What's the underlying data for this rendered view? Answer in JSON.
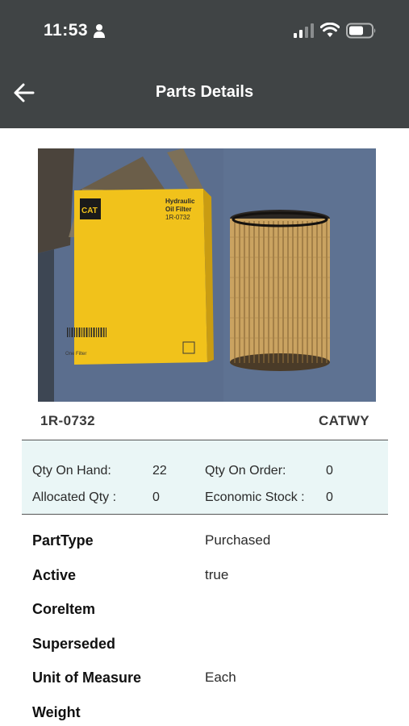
{
  "status_bar": {
    "time": "11:53",
    "icons": [
      "person-icon",
      "signal-icon",
      "wifi-icon",
      "battery-icon"
    ]
  },
  "header": {
    "title": "Parts Details",
    "back_icon": "arrow-left-icon",
    "background": "#404445"
  },
  "photo": {
    "box_brand": "CAT",
    "box_line1": "Hydraulic",
    "box_line2": "Oil Filter",
    "box_part": "1R-0732",
    "box_footer": "One Filter"
  },
  "part": {
    "number": "1R-0732",
    "warehouse": "CATWY"
  },
  "quantities": {
    "on_hand_label": "Qty On Hand:",
    "on_hand_value": "22",
    "on_order_label": "Qty On Order:",
    "on_order_value": "0",
    "allocated_label": "Allocated Qty :",
    "allocated_value": "0",
    "economic_label": "Economic Stock :",
    "economic_value": "0",
    "panel_color": "#eaf6f6"
  },
  "details": [
    {
      "label": "PartType",
      "value": "Purchased"
    },
    {
      "label": "Active",
      "value": "true"
    },
    {
      "label": "CoreItem",
      "value": ""
    },
    {
      "label": "Superseded",
      "value": ""
    },
    {
      "label": "Unit of Measure",
      "value": "Each"
    },
    {
      "label": "Weight",
      "value": ""
    }
  ]
}
